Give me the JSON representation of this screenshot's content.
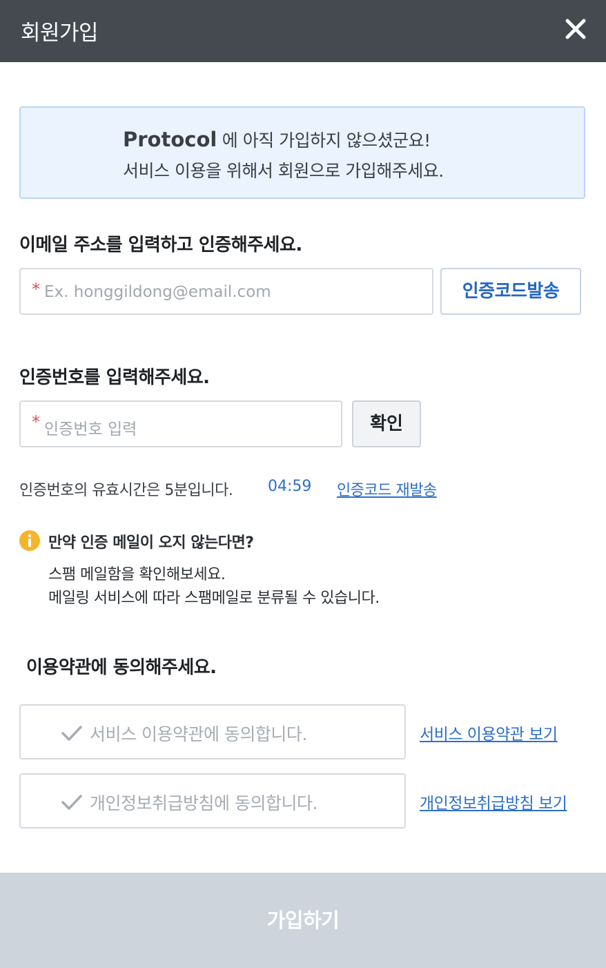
{
  "header": {
    "title": "회원가입",
    "close_icon": "close-icon"
  },
  "banner": {
    "brand": "Protocol",
    "line1_rest": " 에 아직 가입하지 않으셨군요!",
    "line2": "서비스 이용을 위해서 회원으로 가입해주세요."
  },
  "email_section": {
    "title": "이메일 주소를 입력하고 인증해주세요.",
    "required_mark": "*",
    "placeholder": "Ex. honggildong@email.com",
    "send_button": "인증코드발송"
  },
  "code_section": {
    "title": "인증번호를 입력해주세요.",
    "required_mark": "*",
    "placeholder": "인증번호 입력",
    "confirm_button": "확인",
    "validity_message": "인증번호의 유효시간은 5분입니다.",
    "timer": "04:59",
    "resend_link": "인증코드 재발송"
  },
  "notice": {
    "icon": "info-icon",
    "title": "만약 인증 메일이 오지 않는다면?",
    "line1": "스팸 메일함을 확인해보세요.",
    "line2": "메일링 서비스에 따라 스팸메일로 분류될 수 있습니다."
  },
  "terms": {
    "title": "이용약관에 동의해주세요.",
    "items": [
      {
        "label": "서비스 이용약관에 동의합니다.",
        "link": "서비스 이용약관 보기"
      },
      {
        "label": "개인정보취급방침에 동의합니다.",
        "link": "개인정보취급방침 보기"
      }
    ]
  },
  "submit_button": "가입하기",
  "colors": {
    "header_bg": "#454a51",
    "accent_blue": "#2d6fc9",
    "banner_bg": "#eaf3fe",
    "required_red": "#e24f4f",
    "notice_yellow": "#f5b42a",
    "submit_disabled_bg": "#cdd4dc"
  }
}
